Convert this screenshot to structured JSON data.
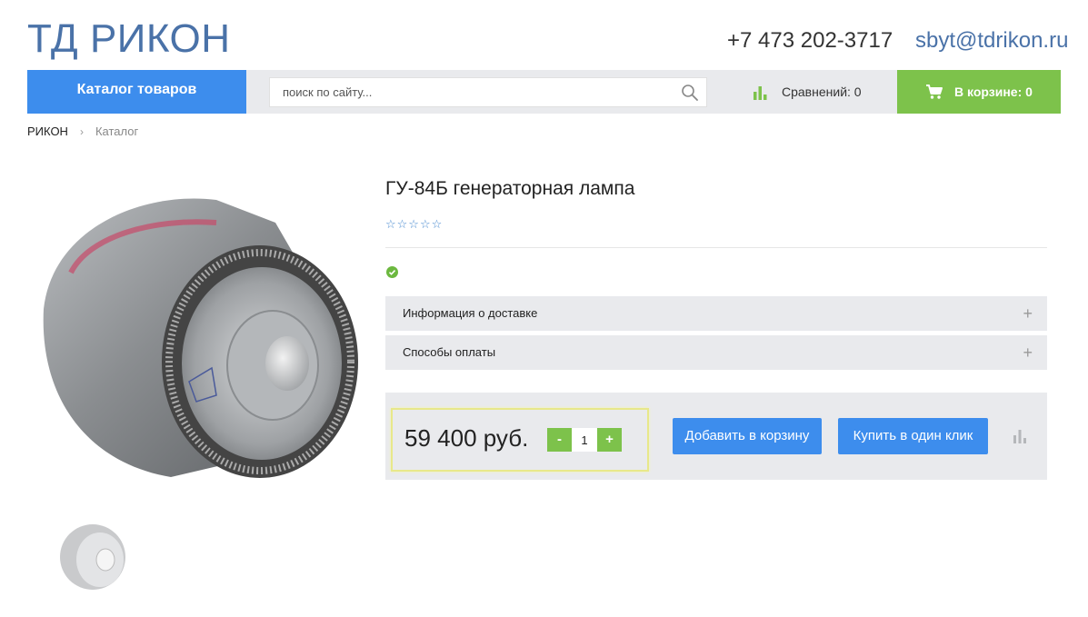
{
  "header": {
    "logo": "ТД РИКОН",
    "phone": "+7 473 202-3717",
    "email": "sbyt@tdrikon.ru"
  },
  "navbar": {
    "catalog_label": "Каталог товаров",
    "search_placeholder": "поиск по сайту...",
    "compare_label": "Сравнений: 0",
    "cart_label": "В корзине: 0",
    "icons": {
      "search": "search-icon",
      "compare": "bar-chart-icon",
      "cart": "cart-icon"
    },
    "colors": {
      "catalog": "#3d8ded",
      "cart": "#7dc24b"
    }
  },
  "breadcrumb": {
    "home": "РИКОН",
    "separator": "›",
    "current": "Каталог"
  },
  "product": {
    "title": "ГУ-84Б генераторная лампа",
    "rating_stars": "☆☆☆☆☆",
    "rating_value": 0,
    "in_stock_icon": "check-circle-icon",
    "accordion": [
      {
        "label": "Информация о доставке",
        "toggle": "+"
      },
      {
        "label": "Способы оплаты",
        "toggle": "+"
      }
    ],
    "price": "59 400 руб.",
    "qty": {
      "minus": "-",
      "value": "1",
      "plus": "+"
    },
    "add_to_cart_label": "Добавить в корзину",
    "one_click_label": "Купить в один клик"
  }
}
